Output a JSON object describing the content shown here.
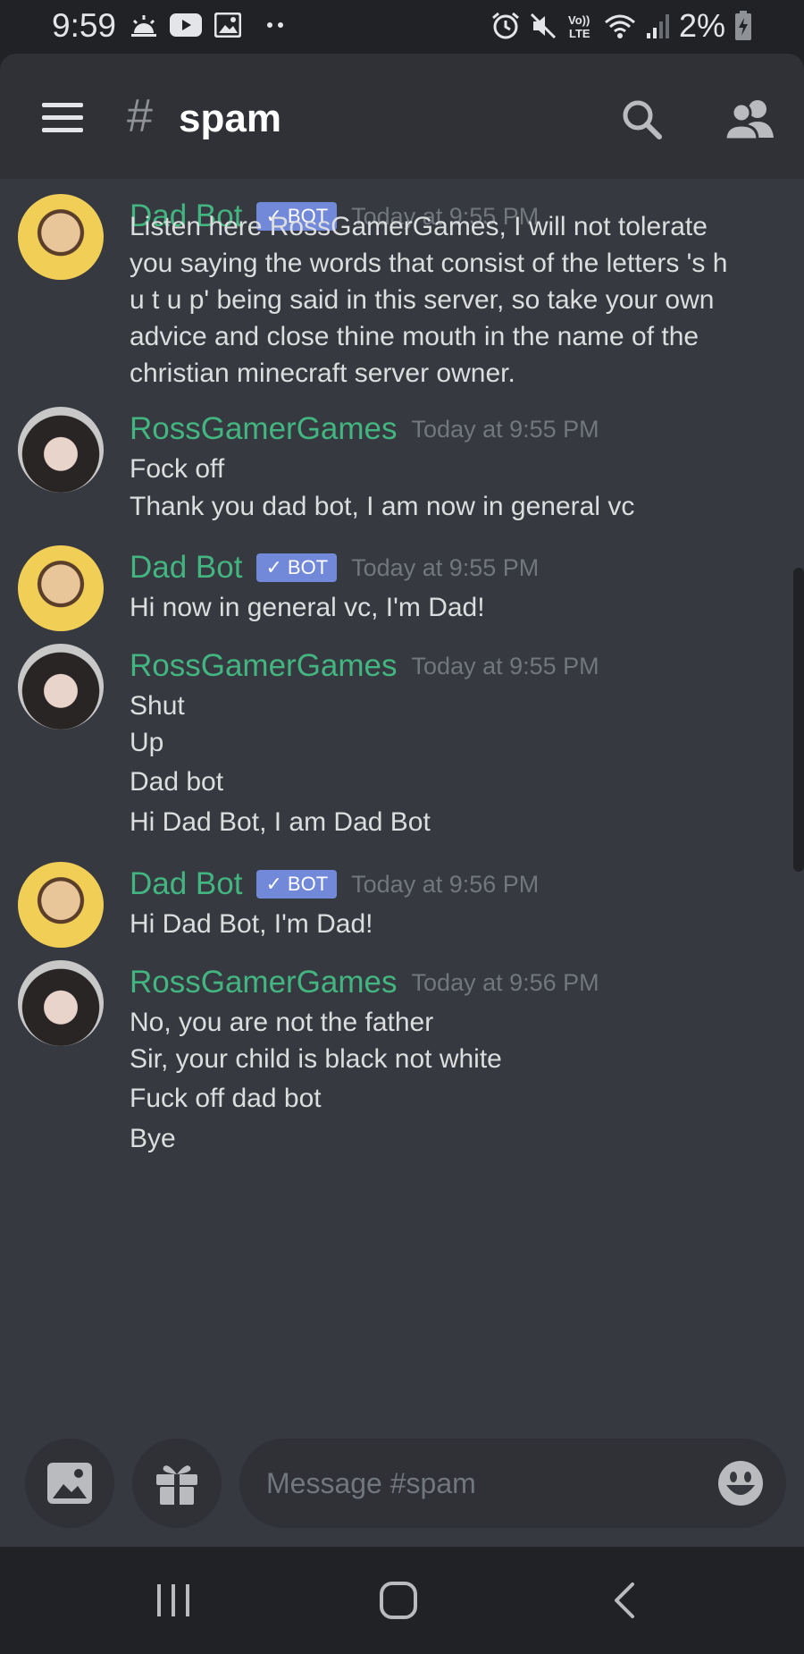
{
  "status_bar": {
    "time": "9:59",
    "battery": "2%",
    "icons": [
      "sunrise-icon",
      "youtube-icon",
      "image-icon",
      "more-dots-icon",
      "alarm-icon",
      "mute-icon",
      "volte-icon",
      "wifi-icon",
      "signal-icon",
      "battery-charging-icon"
    ],
    "volte_text": "Vo)) LTE"
  },
  "header": {
    "hash": "#",
    "channel": "spam"
  },
  "messages": [
    {
      "author": "Dad Bot",
      "bot": true,
      "bot_label": "BOT",
      "timestamp": "Today at 9:55 PM",
      "lines": [
        "Listen here RossGamerGames, I will not tolerate",
        "you saying the words that consist of the letters 's h",
        "u t  u p' being said in this server, so take your own",
        "advice and close thine mouth in the name of the",
        "christian minecraft server owner."
      ]
    },
    {
      "author": "RossGamerGames",
      "bot": false,
      "timestamp": "Today at 9:55 PM",
      "lines": [
        "Fock off",
        "Thank you dad bot, I am now in general vc"
      ]
    },
    {
      "author": "Dad Bot",
      "bot": true,
      "bot_label": "BOT",
      "timestamp": "Today at 9:55 PM",
      "lines": [
        "Hi now in general vc, I'm Dad!"
      ]
    },
    {
      "author": "RossGamerGames",
      "bot": false,
      "timestamp": "Today at 9:55 PM",
      "lines": [
        "Shut",
        "Up",
        "Dad bot",
        "Hi Dad Bot, I am Dad Bot"
      ]
    },
    {
      "author": "Dad Bot",
      "bot": true,
      "bot_label": "BOT",
      "timestamp": "Today at 9:56 PM",
      "lines": [
        "Hi Dad Bot, I'm Dad!"
      ]
    },
    {
      "author": "RossGamerGames",
      "bot": false,
      "timestamp": "Today at 9:56 PM",
      "lines": [
        "No, you are not the father",
        "Sir, your child is black not white",
        "Fuck off dad bot",
        "Bye"
      ]
    }
  ],
  "composer": {
    "placeholder": "Message #spam"
  },
  "colors": {
    "background": "#36393f",
    "header": "#2f3136",
    "author": "#43b581",
    "bot_tag": "#7289da",
    "timestamp": "#72767d",
    "text": "#dcddde"
  }
}
